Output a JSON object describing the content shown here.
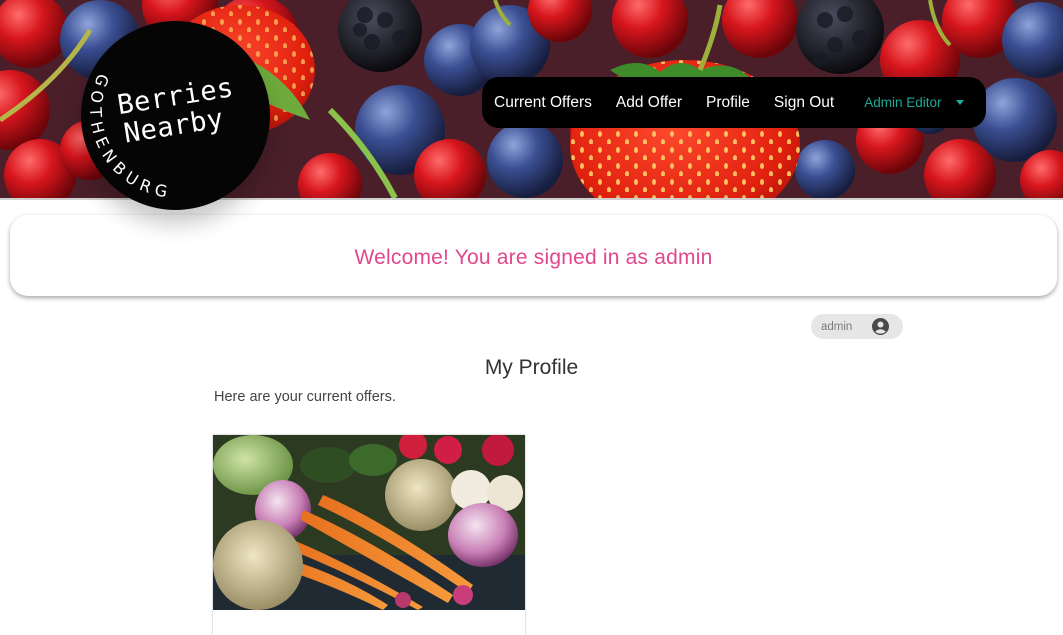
{
  "brand": {
    "line1": "Berries",
    "line2": "Nearby",
    "city": "GOTHENBURG"
  },
  "nav": {
    "items": [
      {
        "label": "Current Offers"
      },
      {
        "label": "Add Offer"
      },
      {
        "label": "Profile"
      },
      {
        "label": "Sign Out"
      }
    ],
    "admin_label": "Admin Editor"
  },
  "welcome": {
    "text": "Welcome! You are signed in as admin"
  },
  "user_chip": {
    "username": "admin"
  },
  "profile": {
    "title": "My Profile",
    "subtitle": "Here are your current offers."
  },
  "offers": [
    {
      "image": "vegetables-photo"
    }
  ],
  "colors": {
    "nav_bg": "#000000",
    "accent_pink": "#e0478c",
    "accent_teal": "#1fa797",
    "chip_bg": "#e6e6e6"
  },
  "icons": {
    "user": "user-circle-icon",
    "caret": "caret-down-icon"
  }
}
